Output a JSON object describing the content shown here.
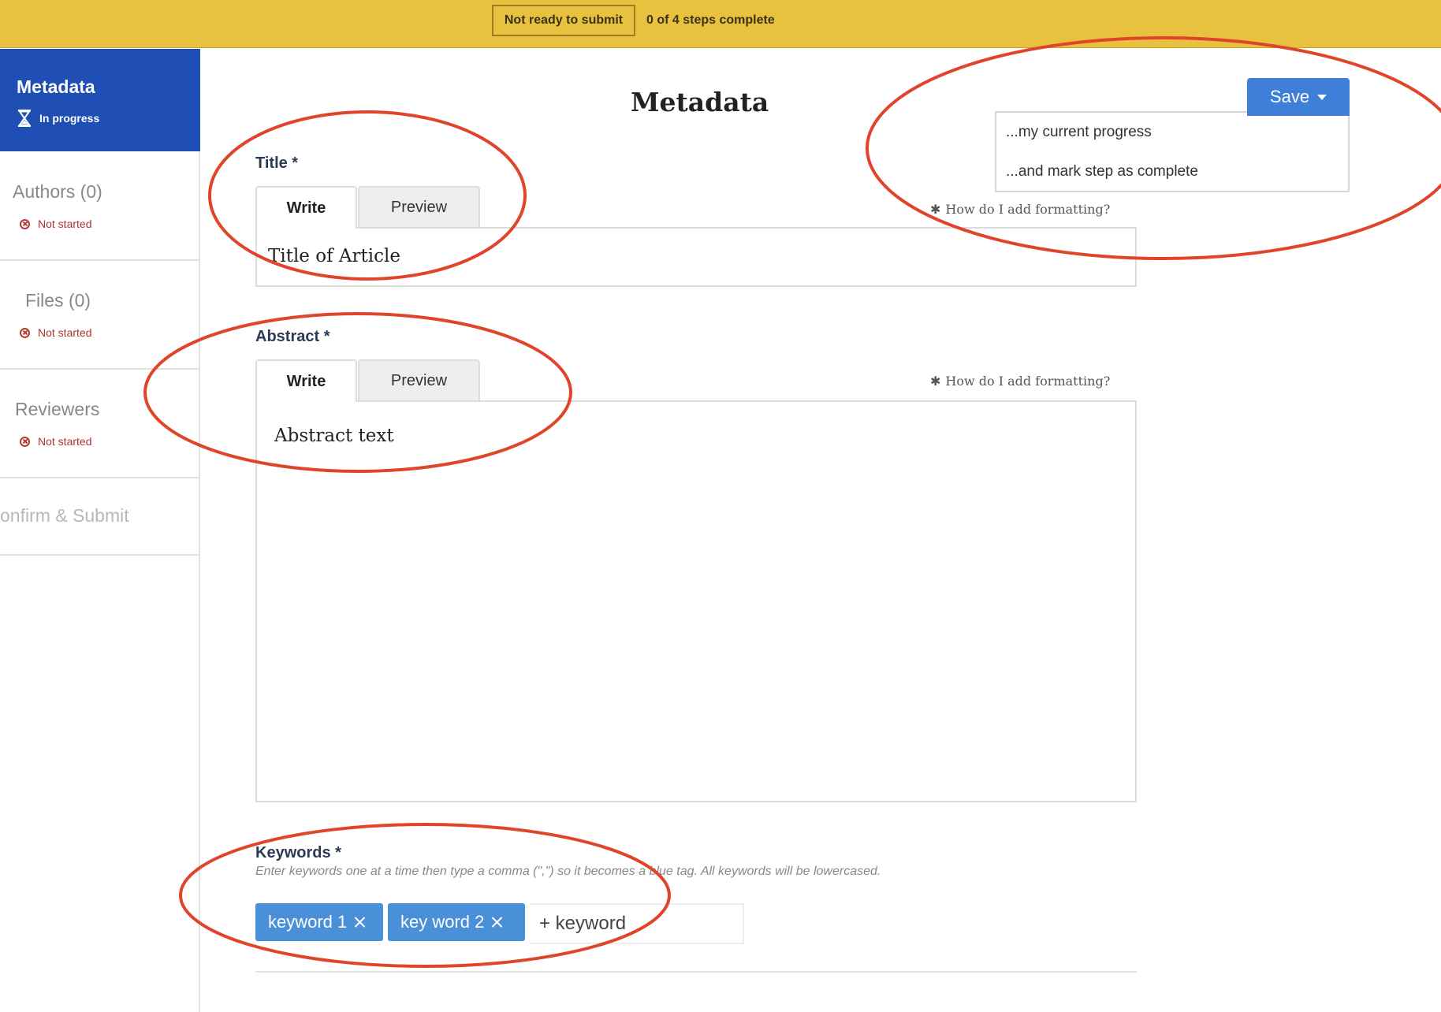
{
  "topbar": {
    "submit_status": "Not ready to submit",
    "steps_progress": "0 of 4  steps complete"
  },
  "sidebar": {
    "items": [
      {
        "label": "Metadata",
        "status": "In progress",
        "status_icon": "hourglass-icon"
      },
      {
        "label": "Authors (0)",
        "status": "Not started",
        "status_icon": "x-circle-icon"
      },
      {
        "label": "Files (0)",
        "status": "Not started",
        "status_icon": "x-circle-icon"
      },
      {
        "label": "Reviewers",
        "status": "Not started",
        "status_icon": "x-circle-icon"
      },
      {
        "label": "onfirm & Submit"
      }
    ]
  },
  "main": {
    "page_title": "Metadata",
    "save": {
      "label": "Save",
      "menu": [
        "...my current progress",
        "...and mark step as complete"
      ]
    },
    "title_field": {
      "label": "Title *",
      "tabs": [
        "Write",
        "Preview"
      ],
      "value": "Title of Article",
      "help": "How do I add formatting?"
    },
    "abstract_field": {
      "label": "Abstract *",
      "tabs": [
        "Write",
        "Preview"
      ],
      "value": "Abstract text",
      "help": "How do I add formatting?"
    },
    "keywords_field": {
      "label": "Keywords *",
      "hint": "Enter keywords one at a time then type a comma (\",\") so it becomes a blue tag. All keywords will be lowercased.",
      "tags": [
        "keyword 1",
        "key word 2"
      ],
      "input_placeholder": "+ keyword"
    }
  },
  "colors": {
    "topbar": "#e8c23f",
    "sidebar_active": "#1f4fb4",
    "save_button": "#3d7fd9",
    "tag": "#4a90d9",
    "annotation": "#e0452c"
  }
}
